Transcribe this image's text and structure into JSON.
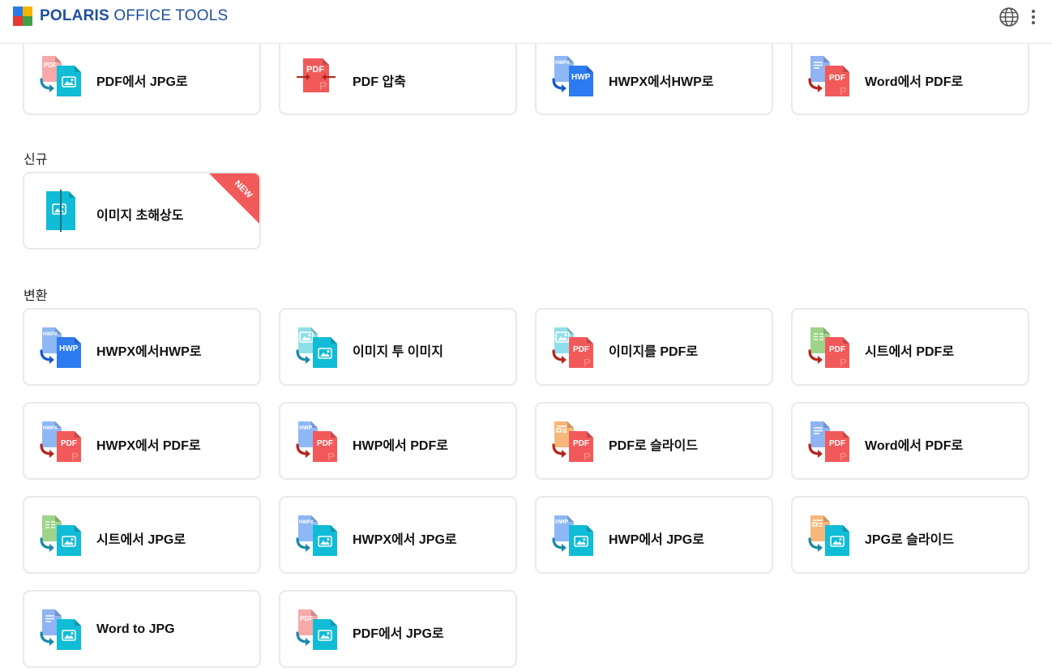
{
  "header": {
    "brand_bold": "POLARIS",
    "brand_light": " OFFICE TOOLS",
    "logo_colors": [
      "#2b7be4",
      "#f5b400",
      "#e53935",
      "#43a047"
    ]
  },
  "sections": {
    "top_row": [
      {
        "label": "PDF에서 JPG로",
        "icon": "pdf-to-jpg-icon"
      },
      {
        "label": "PDF 압축",
        "icon": "pdf-compress-icon"
      },
      {
        "label": "HWPX에서HWP로",
        "icon": "hwpx-to-hwp-icon"
      },
      {
        "label": "Word에서 PDF로",
        "icon": "word-to-pdf-icon"
      }
    ],
    "new": {
      "title": "신규",
      "badge": "NEW",
      "items": [
        {
          "label": "이미지 초해상도",
          "icon": "image-super-resolution-icon"
        }
      ]
    },
    "convert": {
      "title": "변환",
      "items": [
        {
          "label": "HWPX에서HWP로",
          "icon": "hwpx-to-hwp-icon"
        },
        {
          "label": "이미지 투 이미지",
          "icon": "image-to-image-icon"
        },
        {
          "label": "이미지를 PDF로",
          "icon": "image-to-pdf-icon"
        },
        {
          "label": "시트에서 PDF로",
          "icon": "sheet-to-pdf-icon"
        },
        {
          "label": "HWPX에서 PDF로",
          "icon": "hwpx-to-pdf-icon"
        },
        {
          "label": "HWP에서 PDF로",
          "icon": "hwp-to-pdf-icon"
        },
        {
          "label": "PDF로 슬라이드",
          "icon": "pdf-to-slide-icon"
        },
        {
          "label": "Word에서 PDF로",
          "icon": "word-to-pdf-icon"
        },
        {
          "label": "시트에서 JPG로",
          "icon": "sheet-to-jpg-icon"
        },
        {
          "label": "HWPX에서 JPG로",
          "icon": "hwpx-to-jpg-icon"
        },
        {
          "label": "HWP에서 JPG로",
          "icon": "hwp-to-jpg-icon"
        },
        {
          "label": "JPG로 슬라이드",
          "icon": "jpg-to-slide-icon"
        },
        {
          "label": "Word to JPG",
          "icon": "word-to-jpg-icon"
        },
        {
          "label": "PDF에서 JPG로",
          "icon": "pdf-to-jpg-icon"
        }
      ]
    }
  },
  "icon_text": {
    "pdf": "PDF",
    "hwp": "HWP",
    "hwpx": "HWPX"
  },
  "colors": {
    "pdf_red": "#f25a5a",
    "pdf_red_light": "#f7a9a9",
    "hwp_blue": "#2d7bf0",
    "hwp_blue_light": "#8db8f5",
    "image_cyan": "#10bcd6",
    "image_cyan_light": "#8fdfea",
    "sheet_green": "#9ed48a",
    "slide_orange": "#f7b77a",
    "word_blue_light": "#8fb3f3",
    "arrow_teal": "#1a8aa8",
    "arrow_red": "#b3261e",
    "arrow_blue": "#1857c9",
    "badge_red": "#f25a5a"
  }
}
